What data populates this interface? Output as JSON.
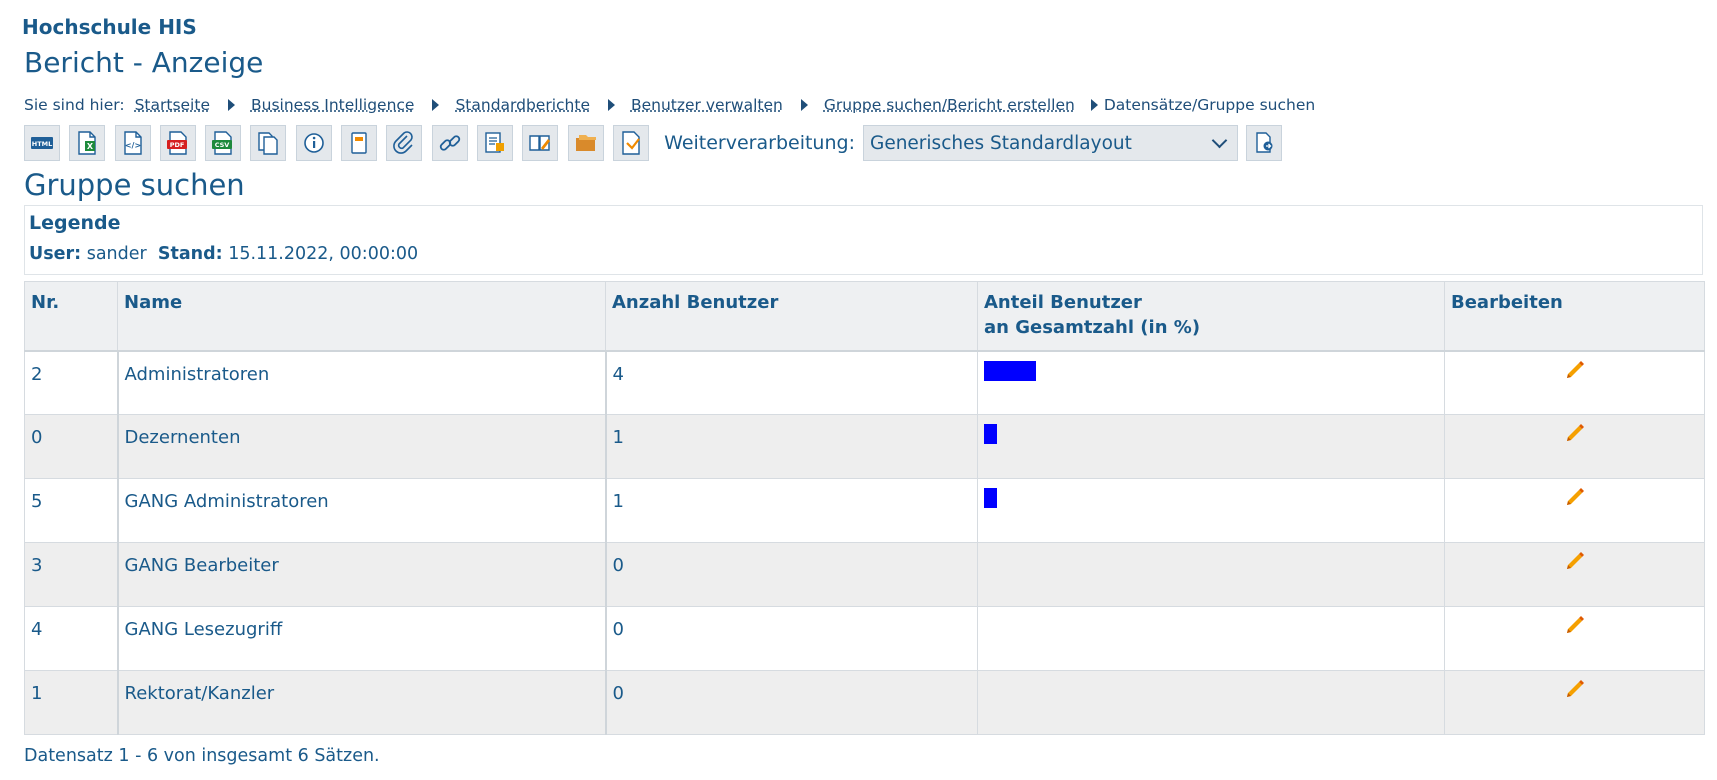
{
  "header": {
    "institution": "Hochschule HIS",
    "page_title": "Bericht - Anzeige"
  },
  "breadcrumb": {
    "label": "Sie sind hier:",
    "items": [
      "Startseite",
      "Business Intelligence",
      "Standardberichte",
      "Benutzer verwalten",
      "Gruppe suchen/Bericht erstellen"
    ],
    "current": "Datensätze/Gruppe suchen"
  },
  "toolbar": {
    "buttons": [
      {
        "icon": "html-export-icon"
      },
      {
        "icon": "excel-export-icon"
      },
      {
        "icon": "xml-export-icon"
      },
      {
        "icon": "pdf-export-icon"
      },
      {
        "icon": "csv-export-icon"
      },
      {
        "icon": "copy-icon"
      },
      {
        "icon": "info-icon"
      },
      {
        "icon": "notebook-icon"
      },
      {
        "icon": "paperclip-icon"
      },
      {
        "icon": "link-icon"
      },
      {
        "icon": "report-edit-icon"
      },
      {
        "icon": "book-edit-icon"
      },
      {
        "icon": "folders-icon"
      },
      {
        "icon": "document-export-icon"
      }
    ],
    "processing_label": "Weiterverarbeitung:",
    "processing_value": "Generisches Standardlayout",
    "go_icon": "document-apply-icon"
  },
  "section": {
    "title": "Gruppe suchen"
  },
  "legend": {
    "title": "Legende",
    "user_label": "User:",
    "user_value": "sander",
    "stand_label": "Stand:",
    "stand_value": "15.11.2022, 00:00:00"
  },
  "table": {
    "headers": [
      "Nr.",
      "Name",
      "Anzahl Benutzer",
      "Anteil Benutzer",
      "an Gesamtzahl (in %)",
      "Bearbeiten"
    ],
    "rows": [
      {
        "nr": "2",
        "name": "Administratoren",
        "count": "4",
        "share": 4
      },
      {
        "nr": "0",
        "name": "Dezernenten",
        "count": "1",
        "share": 1
      },
      {
        "nr": "5",
        "name": "GANG Administratoren",
        "count": "1",
        "share": 1
      },
      {
        "nr": "3",
        "name": "GANG Bearbeiter",
        "count": "0",
        "share": 0
      },
      {
        "nr": "4",
        "name": "GANG Lesezugriff",
        "count": "0",
        "share": 0
      },
      {
        "nr": "1",
        "name": "Rektorat/Kanzler",
        "count": "0",
        "share": 0
      }
    ],
    "bar_color": "#0000ff",
    "edit_icon": "pencil-icon"
  },
  "footer": {
    "record_summary": "Datensatz 1 - 6 von insgesamt 6 Sätzen."
  }
}
